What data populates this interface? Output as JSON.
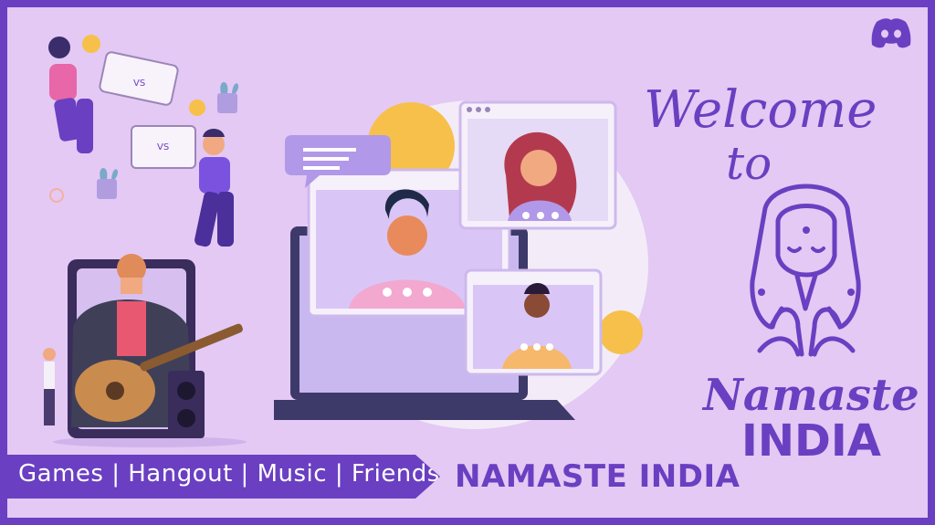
{
  "banner": {
    "text": "Games | Hangout | Music | Friends"
  },
  "tagline": "NAMASTE INDIA",
  "welcome": {
    "line1": "Welcome",
    "line2": "to"
  },
  "brand": {
    "line1": "Namaste",
    "line2": "INDIA"
  },
  "colors": {
    "accent": "#6a3fc1",
    "background": "#e3c9f4",
    "banner_text": "#ffffff"
  },
  "icons": [
    "discord-icon",
    "namaste-woman-illustration",
    "gamers-illustration",
    "guitar-player-illustration",
    "video-call-laptop-illustration",
    "chat-bubble-icon"
  ]
}
